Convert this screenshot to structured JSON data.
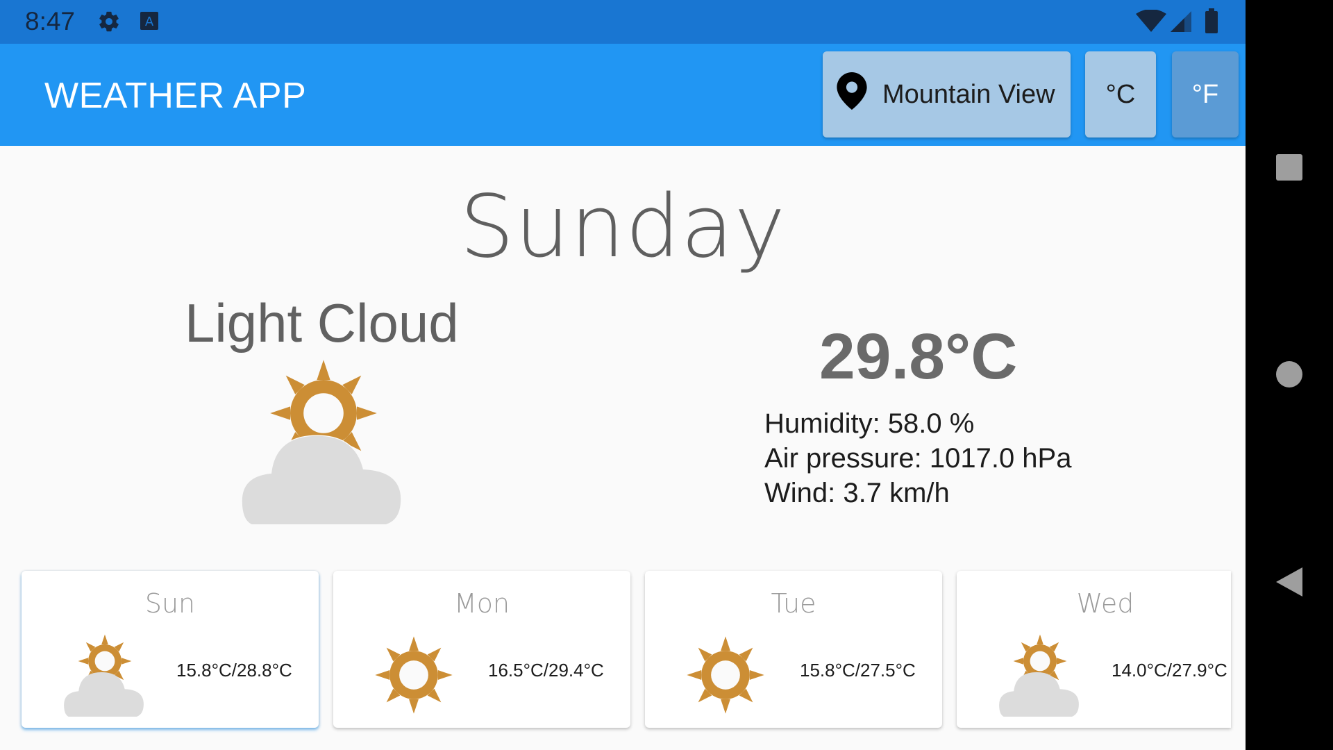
{
  "status_bar": {
    "time": "8:47",
    "icons": [
      "settings-icon",
      "keyboard-a-icon",
      "wifi-icon",
      "cellular-signal-icon",
      "battery-icon"
    ]
  },
  "app_bar": {
    "title": "WEATHER APP",
    "location_label": "Mountain View",
    "celsius_label": "°C",
    "fahrenheit_label": "°F"
  },
  "current": {
    "day": "Sunday",
    "condition": "Light Cloud",
    "icon": "light-cloud-icon",
    "temperature": "29.8°C",
    "humidity": "Humidity: 58.0 %",
    "air_pressure": "Air pressure: 1017.0 hPa",
    "wind": "Wind: 3.7 km/h"
  },
  "forecast": [
    {
      "day": "Sun",
      "icon": "light-cloud-icon",
      "range": "15.8°C/28.8°C"
    },
    {
      "day": "Mon",
      "icon": "clear-sun-icon",
      "range": "16.5°C/29.4°C"
    },
    {
      "day": "Tue",
      "icon": "clear-sun-icon",
      "range": "15.8°C/27.5°C"
    },
    {
      "day": "Wed",
      "icon": "light-cloud-icon",
      "range": "14.0°C/27.9°C"
    }
  ],
  "colors": {
    "status_bar": "#1976d2",
    "app_bar": "#2196f3",
    "sun": "#cc8e35",
    "cloud": "#dcdcdc",
    "selected_unit": "#5b9bd5",
    "unselected_unit": "#a6c8e5"
  },
  "nav_bar": {
    "icons": [
      "recents-square-icon",
      "home-circle-icon",
      "back-triangle-icon"
    ]
  }
}
